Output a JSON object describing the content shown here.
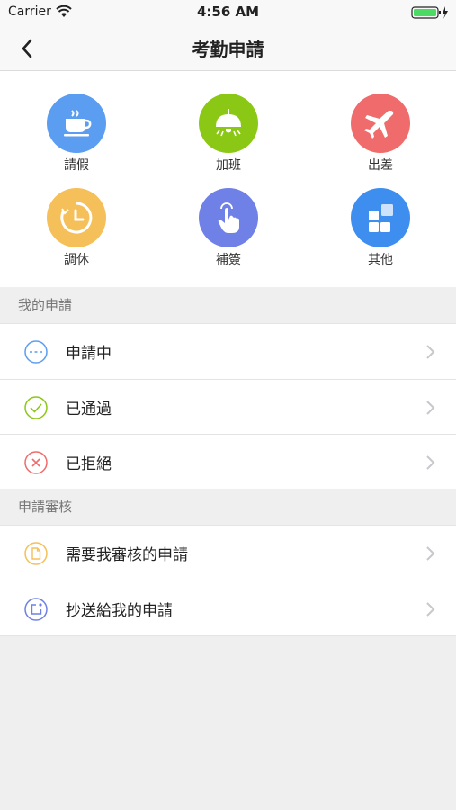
{
  "status": {
    "carrier": "Carrier",
    "time": "4:56 AM"
  },
  "nav": {
    "title": "考勤申請"
  },
  "grid": {
    "items": [
      {
        "label": "請假",
        "color": "#5b9df0",
        "icon": "coffee-icon"
      },
      {
        "label": "加班",
        "color": "#8bc816",
        "icon": "lamp-icon"
      },
      {
        "label": "出差",
        "color": "#f06b6b",
        "icon": "airplane-icon"
      },
      {
        "label": "調休",
        "color": "#f5bf5a",
        "icon": "clock-icon"
      },
      {
        "label": "補簽",
        "color": "#6f80e6",
        "icon": "touch-hand-icon"
      },
      {
        "label": "其他",
        "color": "#3e8ef0",
        "icon": "grid-apps-icon"
      }
    ]
  },
  "my_requests": {
    "header": "我的申請",
    "items": [
      {
        "label": "申請中",
        "icon": "pending-icon",
        "color": "#5b9df0"
      },
      {
        "label": "已通過",
        "icon": "approved-check-icon",
        "color": "#8bc816"
      },
      {
        "label": "已拒絕",
        "icon": "rejected-x-icon",
        "color": "#f06b6b"
      }
    ]
  },
  "review": {
    "header": "申請審核",
    "items": [
      {
        "label": "需要我審核的申請",
        "icon": "document-icon",
        "color": "#f5bf5a"
      },
      {
        "label": "抄送給我的申請",
        "icon": "share-icon",
        "color": "#6f80e6"
      }
    ]
  }
}
